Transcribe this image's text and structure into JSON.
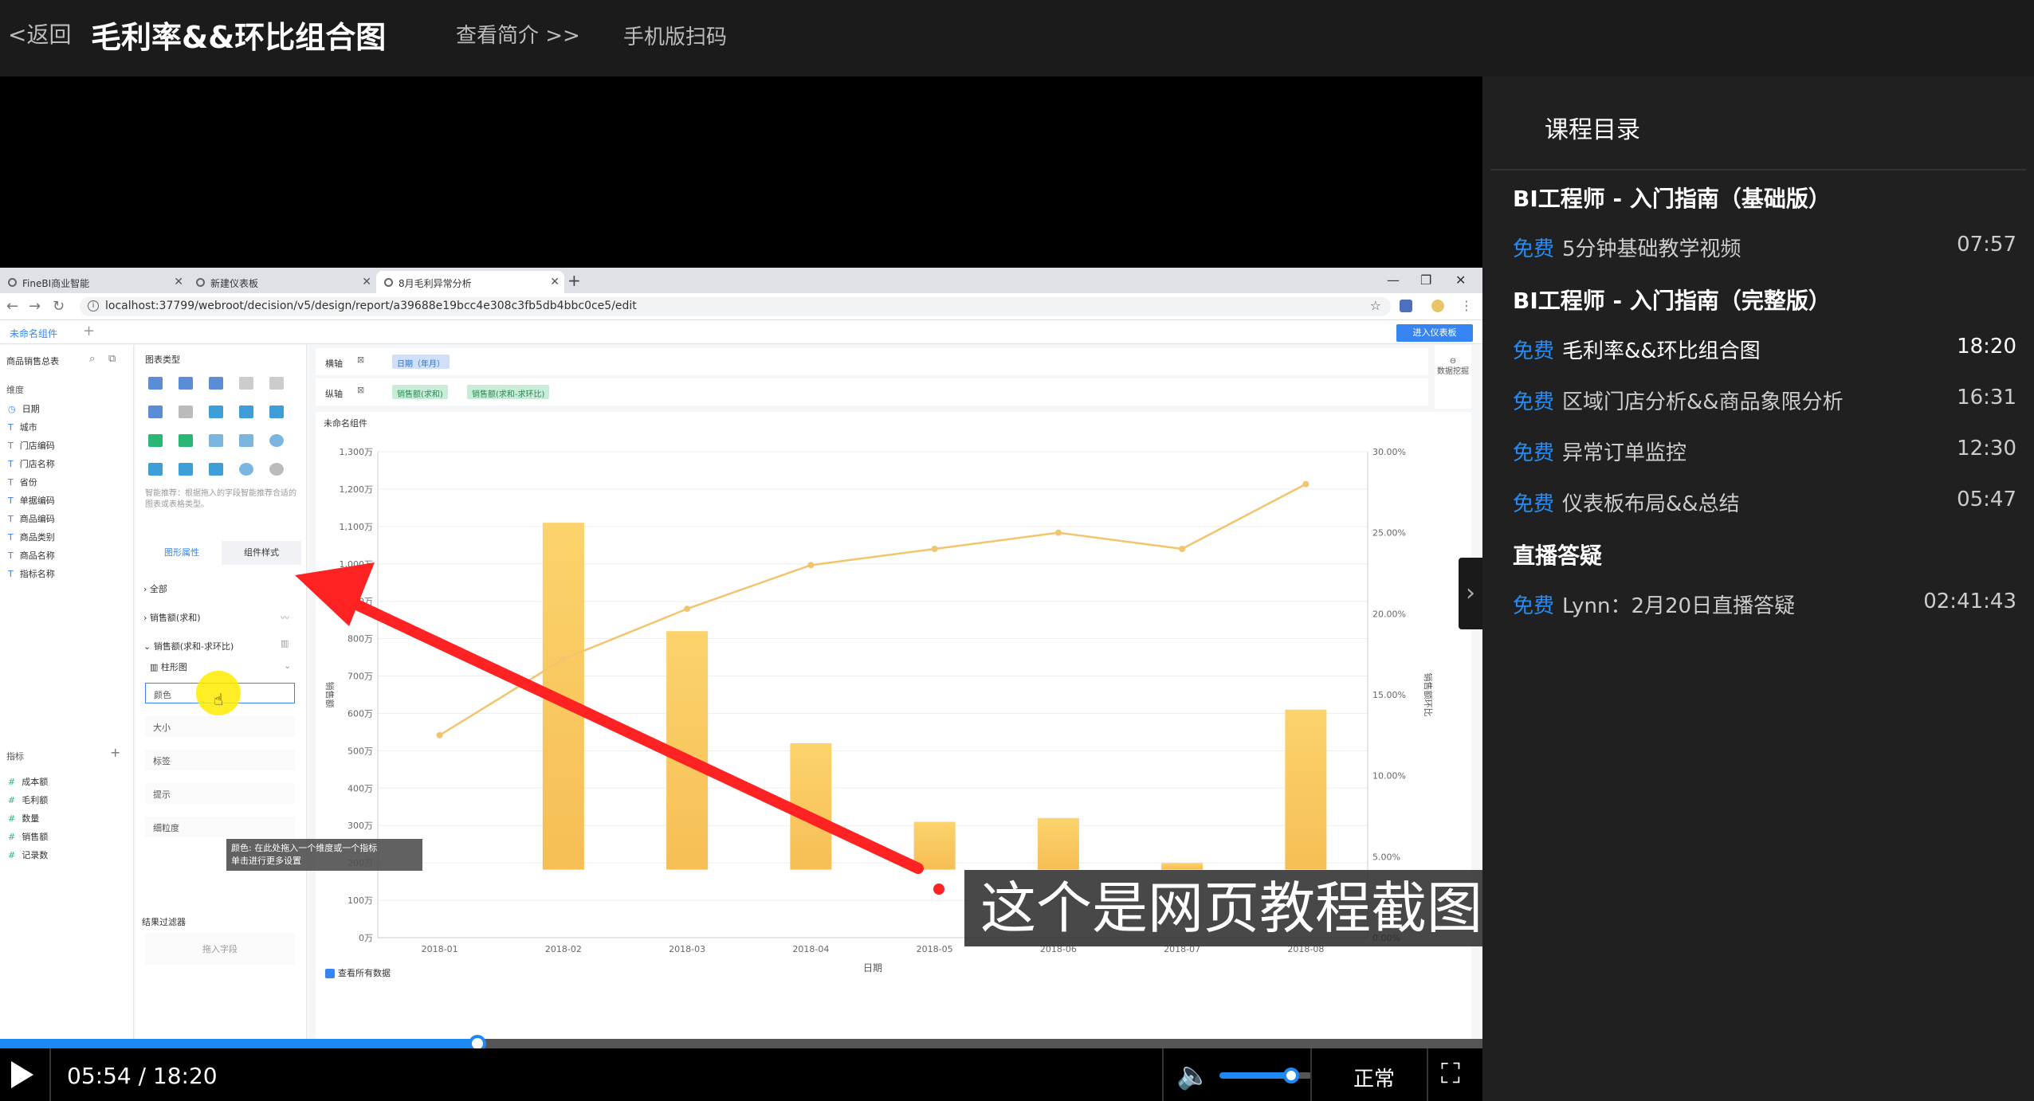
{
  "header": {
    "back_label": "<返回",
    "title": "毛利率&&环比组合图",
    "intro_label": "查看简介 >>",
    "mobile_label": "手机版扫码"
  },
  "browser": {
    "tabs": [
      {
        "label": "FineBI商业智能"
      },
      {
        "label": "新建仪表板"
      },
      {
        "label": "8月毛利异常分析"
      }
    ],
    "url": "localhost:37799/webroot/decision/v5/design/report/a39688e19bcc4e308c3fb5db4bbc0ce5/edit"
  },
  "app": {
    "component_tab": "未命名组件",
    "enter_dashboard": "进入仪表板",
    "left": {
      "table_name": "商品销售总表",
      "dim_section": "维度",
      "dimensions": [
        "日期",
        "城市",
        "门店编码",
        "门店名称",
        "省份",
        "单据编码",
        "商品编码",
        "商品类别",
        "商品名称",
        "指标名称"
      ],
      "measure_section": "指标",
      "measures": [
        "成本额",
        "毛利额",
        "数量",
        "销售额",
        "记录数"
      ]
    },
    "mid": {
      "chart_type_label": "图表类型",
      "hint": "智能推荐：根据拖入的字段智能推荐合适的图表或表格类型。",
      "tab_graph": "图形属性",
      "tab_style": "组件样式",
      "all_label": "全部",
      "sales_label": "销售额(求和)",
      "sales_ratio_label": "销售额(求和-求环比)",
      "chart_kind": "柱形图",
      "color_label": "颜色",
      "size_label": "大小",
      "tag_label": "标签",
      "tip_label": "提示",
      "granularity_label": "细粒度",
      "filter_label": "结果过滤器",
      "drop_field": "拖入字段"
    },
    "axes": {
      "x_label": "横轴",
      "x_pill": "日期（年月）",
      "y_label": "纵轴",
      "y_pill1": "销售额(求和)",
      "y_pill2": "销售额(求和-求环比)",
      "data_mining": "数据挖掘"
    },
    "component_name": "未命名组件",
    "show_all": "查看所有数据",
    "tooltip_line1": "颜色: 在此处拖入一个维度或一个指标",
    "tooltip_line2": "单击进行更多设置"
  },
  "chart_data": {
    "type": "bar",
    "categories": [
      "2018-01",
      "2018-02",
      "2018-03",
      "2018-04",
      "2018-05",
      "2018-06",
      "2018-07",
      "2018-08"
    ],
    "xlabel": "日期",
    "ylabel_left": "销售额",
    "ylabel_right": "销售额环比",
    "left_ticks": [
      "0万",
      "100万",
      "200万",
      "300万",
      "400万",
      "500万",
      "600万",
      "700万",
      "800万",
      "900万",
      "1,000万",
      "1,100万",
      "1,200万",
      "1,300万"
    ],
    "right_ticks": [
      "0.00%",
      "5.00%",
      "10.00%",
      "15.00%",
      "20.00%",
      "25.00%",
      "30.00%"
    ],
    "ylim_left": [
      0,
      1300
    ],
    "ylim_right": [
      0,
      30
    ],
    "series": [
      {
        "name": "销售额(求和)",
        "values": [
          null,
          1110,
          820,
          520,
          310,
          320,
          200,
          610
        ]
      },
      {
        "name": "销售额(求和-求环比)",
        "values": [
          12.5,
          17.2,
          20.3,
          23.0,
          24.0,
          25.0,
          24.0,
          28.0
        ]
      }
    ]
  },
  "caption": "这个是网页教程截图",
  "player": {
    "time": "05:54 / 18:20",
    "progress": 0.3218,
    "volume": 0.75,
    "speed_label": "正常"
  },
  "course": {
    "title": "课程目录",
    "chapters": [
      {
        "name": "BI工程师 - 入门指南（基础版）",
        "lessons": [
          {
            "free": "免费",
            "name": "5分钟基础教学视频",
            "duration": "07:57"
          }
        ]
      },
      {
        "name": "BI工程师 - 入门指南（完整版）",
        "lessons": [
          {
            "free": "免费",
            "name": "毛利率&&环比组合图",
            "duration": "18:20"
          },
          {
            "free": "免费",
            "name": "区域门店分析&&商品象限分析",
            "duration": "16:31"
          },
          {
            "free": "免费",
            "name": "异常订单监控",
            "duration": "12:30"
          },
          {
            "free": "免费",
            "name": "仪表板布局&&总结",
            "duration": "05:47"
          }
        ]
      },
      {
        "name": "直播答疑",
        "lessons": [
          {
            "free": "免费",
            "name": "Lynn：2月20日直播答疑",
            "duration": "02:41:43"
          }
        ]
      }
    ]
  }
}
